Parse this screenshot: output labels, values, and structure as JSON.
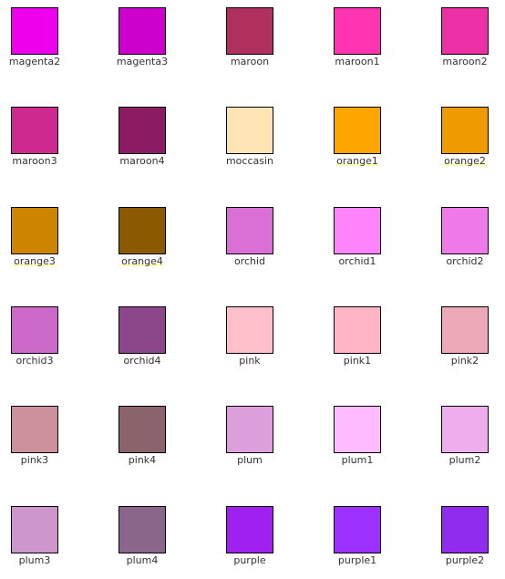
{
  "swatches": [
    {
      "label": "magenta2",
      "color": "#ee00ee",
      "highlight": false
    },
    {
      "label": "magenta3",
      "color": "#cd00cd",
      "highlight": false
    },
    {
      "label": "maroon",
      "color": "#b03060",
      "highlight": false
    },
    {
      "label": "maroon1",
      "color": "#ff34b3",
      "highlight": false
    },
    {
      "label": "maroon2",
      "color": "#ee30a7",
      "highlight": false
    },
    {
      "label": "maroon3",
      "color": "#cd2990",
      "highlight": false
    },
    {
      "label": "maroon4",
      "color": "#8b1c62",
      "highlight": false
    },
    {
      "label": "moccasin",
      "color": "#ffe4b5",
      "highlight": false
    },
    {
      "label": "orange1",
      "color": "#ffa500",
      "highlight": true
    },
    {
      "label": "orange2",
      "color": "#ee9a00",
      "highlight": true
    },
    {
      "label": "orange3",
      "color": "#cd8500",
      "highlight": true
    },
    {
      "label": "orange4",
      "color": "#8b5a00",
      "highlight": true
    },
    {
      "label": "orchid",
      "color": "#da70d6",
      "highlight": false
    },
    {
      "label": "orchid1",
      "color": "#ff83fa",
      "highlight": false
    },
    {
      "label": "orchid2",
      "color": "#ee7ae9",
      "highlight": false
    },
    {
      "label": "orchid3",
      "color": "#cd69c9",
      "highlight": false
    },
    {
      "label": "orchid4",
      "color": "#8b4789",
      "highlight": false
    },
    {
      "label": "pink",
      "color": "#ffc0cb",
      "highlight": false
    },
    {
      "label": "pink1",
      "color": "#ffb5c5",
      "highlight": false
    },
    {
      "label": "pink2",
      "color": "#eea9b8",
      "highlight": false
    },
    {
      "label": "pink3",
      "color": "#cd919e",
      "highlight": false
    },
    {
      "label": "pink4",
      "color": "#8b636c",
      "highlight": false
    },
    {
      "label": "plum",
      "color": "#dda0dd",
      "highlight": false
    },
    {
      "label": "plum1",
      "color": "#ffbbff",
      "highlight": false
    },
    {
      "label": "plum2",
      "color": "#eeaeee",
      "highlight": false
    },
    {
      "label": "plum3",
      "color": "#cd96cd",
      "highlight": false
    },
    {
      "label": "plum4",
      "color": "#8b668b",
      "highlight": false
    },
    {
      "label": "purple",
      "color": "#a020f0",
      "highlight": false
    },
    {
      "label": "purple1",
      "color": "#9b30ff",
      "highlight": false
    },
    {
      "label": "purple2",
      "color": "#912cee",
      "highlight": false
    }
  ]
}
